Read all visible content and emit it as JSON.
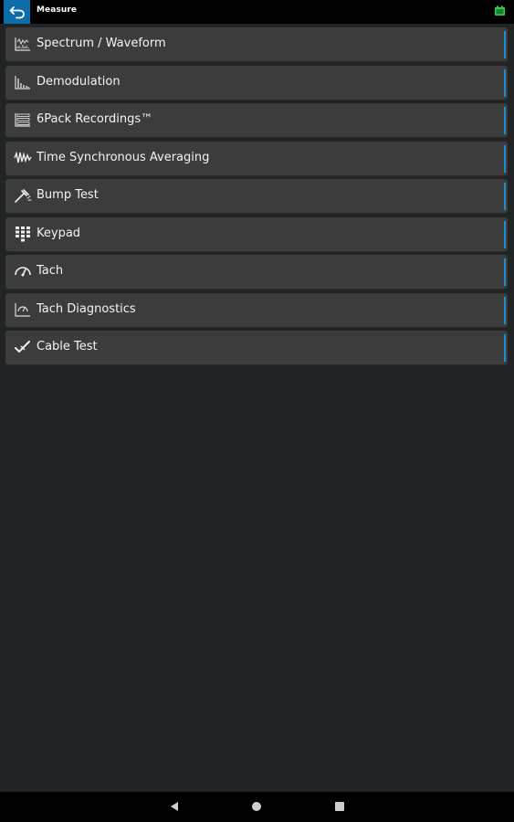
{
  "header": {
    "title": "Measure",
    "back_icon": "back-arrow-icon",
    "battery_icon": "battery-icon",
    "accent_color": "#0c6da8"
  },
  "menu": {
    "items": [
      {
        "label": "Spectrum / Waveform",
        "icon": "spectrum-waveform-icon"
      },
      {
        "label": "Demodulation",
        "icon": "demodulation-icon"
      },
      {
        "label": "6Pack Recordings™",
        "icon": "6pack-recordings-icon"
      },
      {
        "label": "Time Synchronous Averaging",
        "icon": "tsa-icon"
      },
      {
        "label": "Bump Test",
        "icon": "bump-test-icon"
      },
      {
        "label": "Keypad",
        "icon": "keypad-icon"
      },
      {
        "label": "Tach",
        "icon": "tach-icon"
      },
      {
        "label": "Tach Diagnostics",
        "icon": "tach-diagnostics-icon"
      },
      {
        "label": "Cable Test",
        "icon": "cable-test-icon"
      }
    ],
    "item_accent_color": "#1c8fd0"
  },
  "navbar": {
    "back": "nav-back-icon",
    "home": "nav-home-icon",
    "recents": "nav-recents-icon"
  }
}
